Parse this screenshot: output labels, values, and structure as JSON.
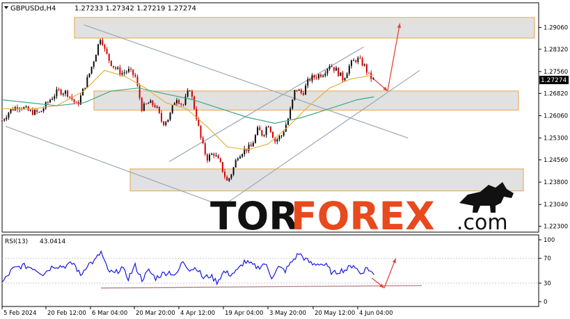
{
  "header": {
    "symbol": "GBPUSDd,H4",
    "quote": "1.27233 1.27342 1.27219 1.27274"
  },
  "current_price_label": "1.27274",
  "rsi_header": {
    "name": "RSI(13)",
    "value": "43.0414"
  },
  "brand": {
    "tor": "TOR",
    "forex": "FOREX",
    "dotcom": ".com"
  },
  "colors": {
    "up_candle": "#0a0a0a",
    "down_candle": "#d40000",
    "ma_fast": "#e3b23c",
    "ma_slow": "#3aa88a",
    "channel": "#9aa7b4",
    "zone_fill": "#dcdcdc",
    "zone_border": "#e8a44a",
    "arrow": "#e2453b",
    "rsi_line": "#1515e6",
    "rsi_support": "#b08080",
    "brand_red": "#e8491d",
    "brand_black": "#111111"
  },
  "chart_data": [
    {
      "type": "candlestick",
      "instrument": "GBPUSDd",
      "timeframe": "H4",
      "ylim": [
        1.221,
        1.299
      ],
      "y_ticks": [
        "1.29060",
        "1.28320",
        "1.27560",
        "1.26820",
        "1.26060",
        "1.25300",
        "1.24560",
        "1.23800",
        "1.23040",
        "1.22300"
      ],
      "x_ticks": [
        "5 Feb 2024",
        "20 Feb 12:00",
        "6 Mar 04:00",
        "20 Mar 20:00",
        "4 Apr 12:00",
        "19 Apr 04:00",
        "3 May 20:00",
        "20 May 12:00",
        "4 Jun 04:00"
      ],
      "close_path": {
        "x": [
          0,
          12,
          25,
          40,
          55,
          70,
          82,
          95,
          110,
          120,
          128,
          135,
          140,
          145,
          150,
          158,
          165,
          175,
          185,
          195,
          205,
          215,
          225,
          235,
          245,
          255,
          265,
          275,
          285,
          292,
          300,
          310,
          320,
          330,
          338,
          345,
          355,
          365,
          375,
          382,
          390,
          400,
          410,
          420,
          430,
          440,
          450,
          460,
          470,
          480,
          490,
          500,
          510,
          520,
          530,
          538,
          545
        ],
        "y": [
          1.259,
          1.2625,
          1.264,
          1.262,
          1.2615,
          1.266,
          1.269,
          1.2685,
          1.264,
          1.27,
          1.275,
          1.28,
          1.284,
          1.288,
          1.283,
          1.279,
          1.277,
          1.275,
          1.276,
          1.274,
          1.263,
          1.265,
          1.264,
          1.258,
          1.26,
          1.267,
          1.264,
          1.27,
          1.26,
          1.252,
          1.246,
          1.248,
          1.244,
          1.238,
          1.242,
          1.247,
          1.249,
          1.25,
          1.256,
          1.254,
          1.258,
          1.252,
          1.254,
          1.26,
          1.27,
          1.268,
          1.273,
          1.274,
          1.275,
          1.278,
          1.276,
          1.273,
          1.278,
          1.28,
          1.278,
          1.274,
          1.27274
        ]
      },
      "ma_fast": {
        "x": [
          0,
          40,
          80,
          120,
          150,
          180,
          210,
          240,
          270,
          300,
          330,
          360,
          390,
          420,
          450,
          480,
          510,
          545
        ],
        "y": [
          1.263,
          1.2628,
          1.264,
          1.269,
          1.276,
          1.274,
          1.27,
          1.265,
          1.263,
          1.257,
          1.25,
          1.249,
          1.251,
          1.257,
          1.264,
          1.27,
          1.273,
          1.2745
        ]
      },
      "ma_slow": {
        "x": [
          0,
          40,
          80,
          120,
          160,
          200,
          240,
          280,
          320,
          360,
          400,
          440,
          480,
          520,
          545
        ],
        "y": [
          1.266,
          1.265,
          1.264,
          1.265,
          1.269,
          1.27,
          1.268,
          1.266,
          1.263,
          1.26,
          1.258,
          1.26,
          1.263,
          1.266,
          1.267
        ]
      },
      "zones": [
        {
          "top": 1.294,
          "bottom": 1.287
        },
        {
          "top": 1.269,
          "bottom": 1.2625
        },
        {
          "top": 1.2425,
          "bottom": 1.235
        }
      ],
      "trendlines": [
        {
          "from": [
            120,
            1.2915
          ],
          "to": [
            595,
            1.253
          ]
        },
        {
          "from": [
            5,
            1.257
          ],
          "to": [
            310,
            1.231
          ]
        },
        {
          "from": [
            245,
            1.245
          ],
          "to": [
            530,
            1.284
          ]
        },
        {
          "from": [
            330,
            1.231
          ],
          "to": [
            612,
            1.276
          ]
        }
      ],
      "arrows": [
        {
          "from": [
            545,
            1.273
          ],
          "to": [
            565,
            1.269
          ]
        },
        {
          "from": [
            565,
            1.269
          ],
          "to": [
            583,
            1.292
          ]
        }
      ],
      "last_price": 1.27274
    },
    {
      "type": "line",
      "indicator": "RSI(13)",
      "ylim": [
        0,
        100
      ],
      "y_ticks": [
        100,
        70,
        30,
        0
      ],
      "last_value": 43.0414,
      "x": [
        0,
        15,
        30,
        45,
        60,
        75,
        90,
        105,
        115,
        125,
        135,
        145,
        155,
        165,
        175,
        185,
        195,
        205,
        215,
        225,
        235,
        245,
        255,
        265,
        275,
        285,
        295,
        305,
        315,
        325,
        335,
        345,
        355,
        365,
        375,
        385,
        395,
        405,
        415,
        425,
        435,
        445,
        455,
        465,
        475,
        485,
        495,
        505,
        515,
        525,
        535,
        545
      ],
      "values": [
        30,
        52,
        58,
        55,
        45,
        58,
        57,
        62,
        42,
        60,
        65,
        80,
        50,
        45,
        55,
        38,
        58,
        36,
        50,
        38,
        45,
        48,
        42,
        66,
        52,
        55,
        38,
        42,
        32,
        48,
        44,
        50,
        65,
        60,
        55,
        62,
        40,
        55,
        50,
        65,
        78,
        68,
        60,
        62,
        58,
        45,
        50,
        52,
        60,
        45,
        55,
        43
      ],
      "support_line": {
        "from": [
          145,
          22
        ],
        "to": [
          615,
          26
        ]
      },
      "arrows": [
        {
          "from": [
            542,
            38
          ],
          "to": [
            560,
            22
          ]
        },
        {
          "from": [
            560,
            22
          ],
          "to": [
            577,
            70
          ]
        }
      ]
    }
  ]
}
